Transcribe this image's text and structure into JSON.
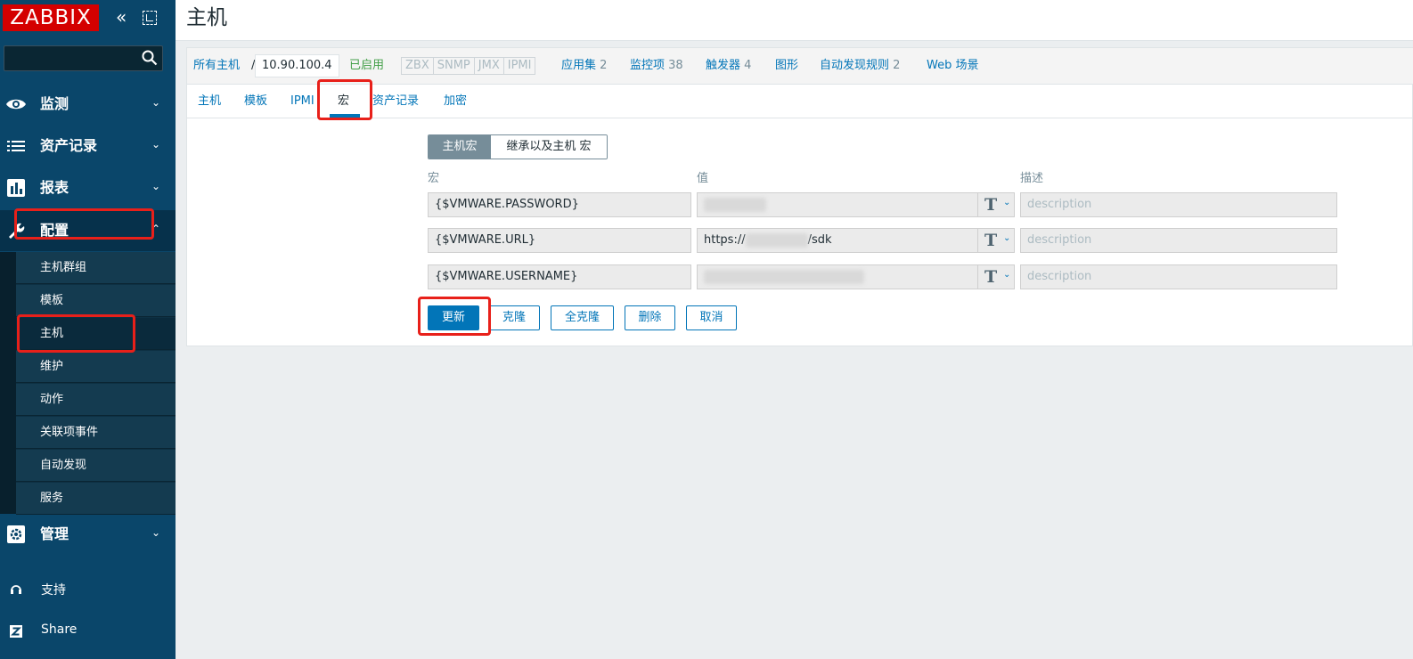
{
  "sidebar": {
    "logo": "ZABBIX",
    "search_value": "",
    "menu": {
      "monitoring": "监测",
      "inventory": "资产记录",
      "reports": "报表",
      "configuration": "配置",
      "administration": "管理"
    },
    "submenu": [
      "主机群组",
      "模板",
      "主机",
      "维护",
      "动作",
      "关联项事件",
      "自动发现",
      "服务"
    ],
    "support": "支持",
    "share": "Share"
  },
  "header": {
    "title": "主机"
  },
  "breadcrumb": {
    "all_hosts": "所有主机",
    "separator": "/",
    "host": "10.90.100.4",
    "status": "已启用",
    "availability": [
      "ZBX",
      "SNMP",
      "JMX",
      "IPMI"
    ],
    "applications": "应用集",
    "applications_count": "2",
    "items": "监控项",
    "items_count": "38",
    "triggers": "触发器",
    "triggers_count": "4",
    "graphs": "图形",
    "discovery": "自动发现规则",
    "discovery_count": "2",
    "web": "Web 场景"
  },
  "tabs": [
    "主机",
    "模板",
    "IPMI",
    "宏",
    "资产记录",
    "加密"
  ],
  "macros": {
    "toggle_host": "主机宏",
    "toggle_inherited": "继承以及主机 宏",
    "col_macro": "宏",
    "col_value": "值",
    "col_desc": "描述",
    "type_symbol": "T",
    "rows": [
      {
        "macro": "{$VMWARE.PASSWORD}",
        "value_pre": "",
        "value_post": "",
        "desc_placeholder": "description"
      },
      {
        "macro": "{$VMWARE.URL}",
        "value_pre": "https://",
        "value_post": "/sdk",
        "desc_placeholder": "description"
      },
      {
        "macro": "{$VMWARE.USERNAME}",
        "value_pre": "",
        "value_post": "",
        "desc_placeholder": "description"
      }
    ]
  },
  "buttons": {
    "update": "更新",
    "clone": "克隆",
    "full_clone": "全克隆",
    "delete": "删除",
    "cancel": "取消"
  },
  "colors": {
    "sidebar": "#0a466a",
    "logo": "#d40000",
    "link": "#0275b8",
    "enabled": "#429e47",
    "annotation": "#e8201a"
  }
}
